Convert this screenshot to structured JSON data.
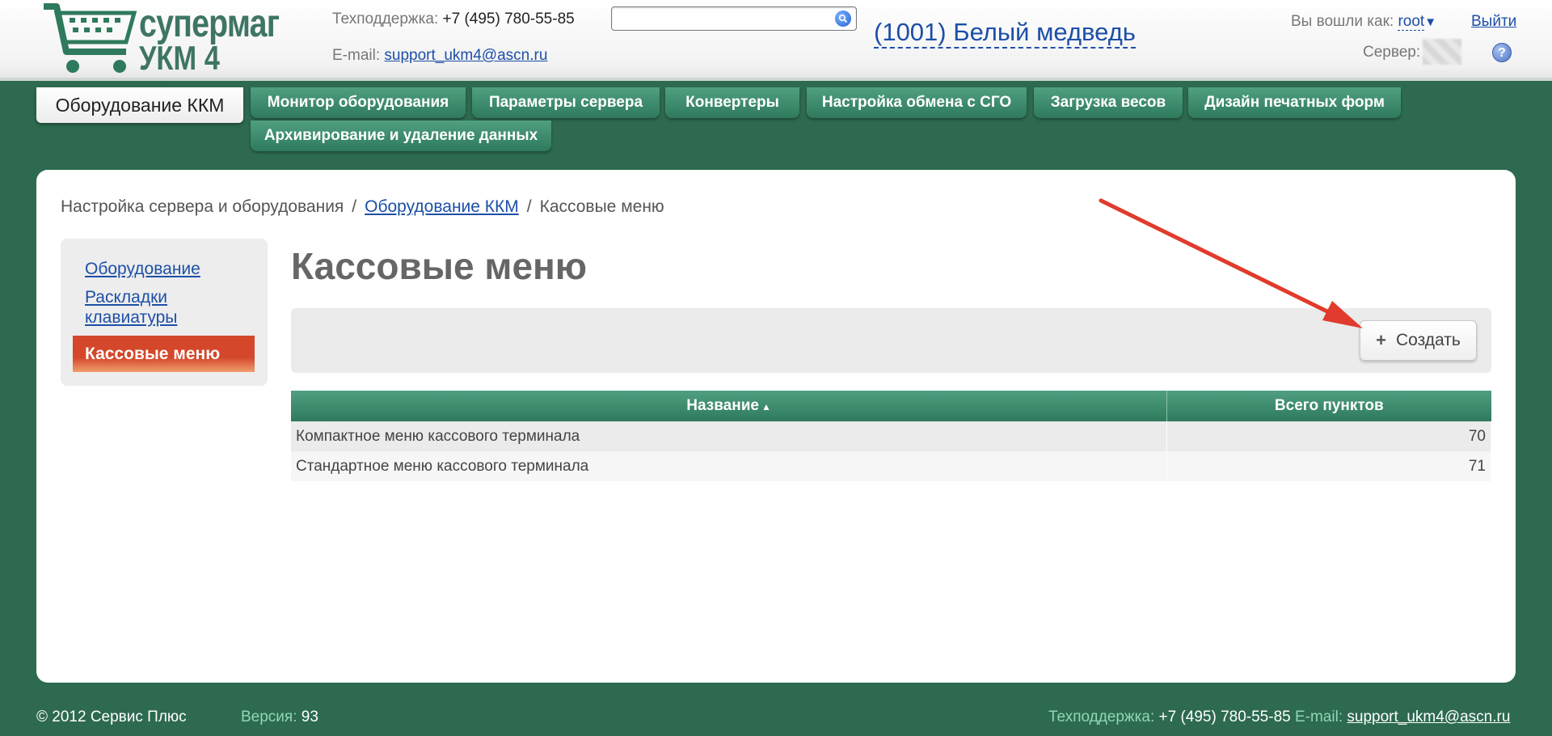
{
  "header": {
    "logo_line1": "супермаг",
    "logo_line2": "УКМ 4",
    "support_phone_label": "Техподдержка:",
    "support_phone": "+7 (495) 780-55-85",
    "email_label": "E-mail:",
    "email": "support_ukm4@ascn.ru",
    "search": {
      "value": "",
      "placeholder": ""
    },
    "store_name": "(1001) Белый медведь",
    "login_label": "Вы вошли как:",
    "user": "root",
    "logout": "Выйти",
    "server_label": "Сервер:",
    "help": "?"
  },
  "nav": {
    "active": "Оборудование ККМ",
    "tabs": [
      "Монитор оборудования",
      "Параметры сервера",
      "Конвертеры",
      "Настройка обмена с СГО",
      "Загрузка весов",
      "Дизайн печатных форм",
      "Архивирование и удаление данных"
    ]
  },
  "breadcrumb": {
    "items": [
      "Настройка сервера и оборудования",
      "Оборудование ККМ",
      "Кассовые меню"
    ],
    "separator": "/"
  },
  "sidebar": {
    "items": [
      "Оборудование",
      "Раскладки клавиатуры",
      "Кассовые меню"
    ]
  },
  "main": {
    "title": "Кассовые меню",
    "create_label": "Создать",
    "table": {
      "columns": [
        "Название",
        "Всего пунктов"
      ],
      "sort_indicator": "▲",
      "rows": [
        [
          "Компактное меню кассового терминала",
          "70"
        ],
        [
          "Стандартное меню кассового терминала",
          "71"
        ]
      ]
    }
  },
  "footer": {
    "copyright": "© 2012 Сервис Плюс",
    "version_label": "Версия:",
    "version": "93",
    "support_label": "Техподдержка:",
    "support_phone": "+7 (495) 780-55-85",
    "email_label": "E-mail:",
    "email": "support_ukm4@ascn.ru"
  },
  "colors": {
    "background": "#2d6a50",
    "tab_green": "#3f8d6d",
    "active_red": "#d4472a",
    "link_blue": "#1d4fa8",
    "annotation_arrow": "#e03b2c"
  }
}
